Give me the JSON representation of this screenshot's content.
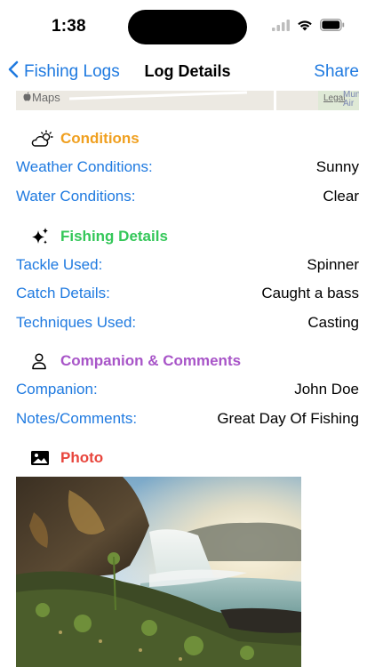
{
  "status": {
    "time": "1:38"
  },
  "nav": {
    "back_label": "Fishing Logs",
    "title": "Log Details",
    "share_label": "Share"
  },
  "map": {
    "logo_label": "Maps",
    "legal_label": "Legal",
    "city_label": "Mun Air"
  },
  "colors": {
    "blue": "#1f7ae0",
    "orange": "#f0a020",
    "green": "#34c759",
    "purple": "#a855c8",
    "red": "#e8453c"
  },
  "sections": {
    "conditions": {
      "title": "Conditions",
      "icon": "cloud-sun-icon",
      "rows": [
        {
          "label": "Weather Conditions:",
          "value": "Sunny"
        },
        {
          "label": "Water Conditions:",
          "value": "Clear"
        }
      ]
    },
    "fishing": {
      "title": "Fishing Details",
      "icon": "sparkles-icon",
      "rows": [
        {
          "label": "Tackle Used:",
          "value": "Spinner"
        },
        {
          "label": "Catch Details:",
          "value": "Caught a bass"
        },
        {
          "label": "Techniques Used:",
          "value": "Casting"
        }
      ]
    },
    "companion": {
      "title": "Companion & Comments",
      "icon": "person-icon",
      "rows": [
        {
          "label": "Companion:",
          "value": "John Doe"
        },
        {
          "label": "Notes/Comments:",
          "value": "Great Day Of Fishing"
        }
      ]
    },
    "photo": {
      "title": "Photo",
      "icon": "photo-icon"
    }
  }
}
